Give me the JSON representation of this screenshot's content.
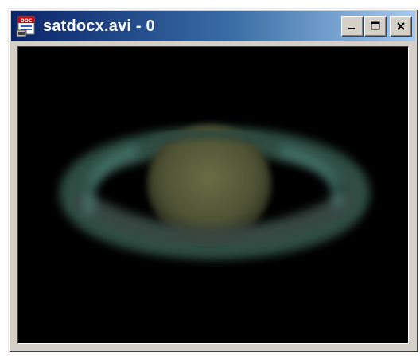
{
  "window": {
    "title": "satdocx.avi - 0",
    "icon": "avi-document-icon",
    "controls": {
      "minimize_icon": "minimize-icon",
      "maximize_icon": "maximize-icon",
      "close_icon": "close-icon"
    }
  },
  "video": {
    "subject": "saturn-frame",
    "colors": {
      "background": "#000000",
      "planet": "#5a5c3a",
      "rings": "#3c6a5c"
    }
  }
}
